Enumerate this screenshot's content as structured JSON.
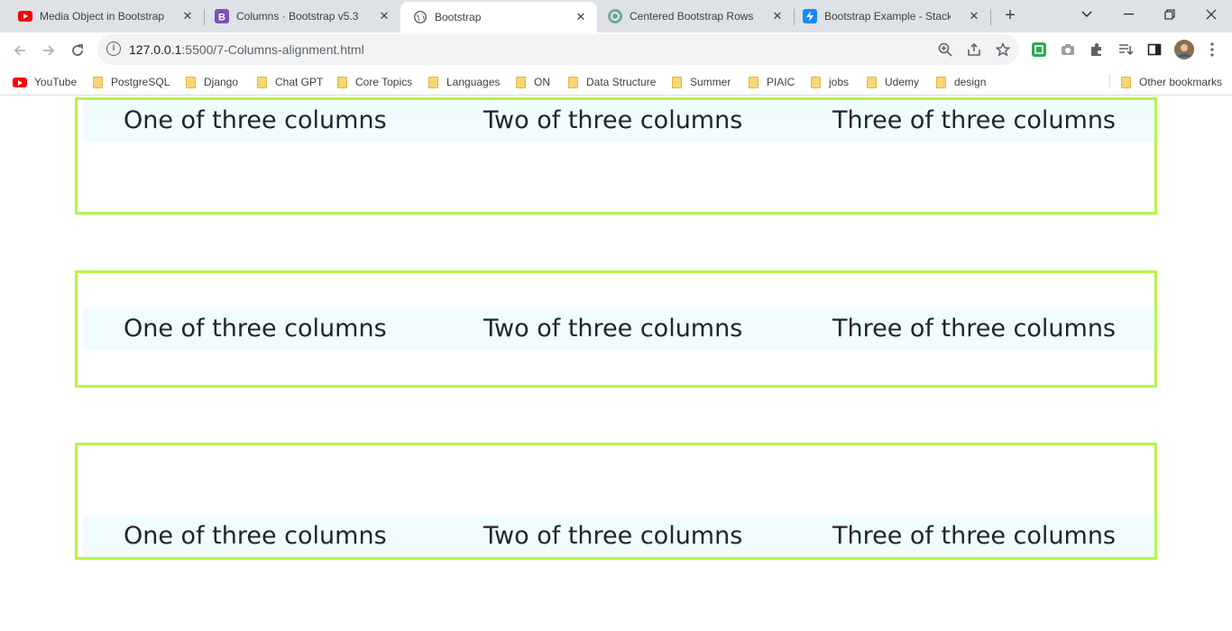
{
  "browser": {
    "tabs": [
      {
        "title": "Media Object in Bootstrap (H",
        "favicon": "youtube-icon"
      },
      {
        "title": "Columns · Bootstrap v5.3",
        "favicon": "bootstrap-icon"
      },
      {
        "title": "Bootstrap",
        "favicon": "globe-icon"
      },
      {
        "title": "Centered Bootstrap Rows",
        "favicon": "chatgpt-icon"
      },
      {
        "title": "Bootstrap Example - StackBlit",
        "favicon": "stackblitz-icon"
      }
    ],
    "active_tab_index": 2,
    "url_host": "127.0.0.1",
    "url_rest": ":5500/7-Columns-alignment.html",
    "bookmarks": [
      "YouTube",
      "PostgreSQL",
      "Django",
      "Chat GPT",
      "Core Topics",
      "Languages",
      "ON",
      "Data Structure",
      "Summer",
      "PIAIC",
      "jobs",
      "Udemy",
      "design"
    ],
    "other_bookmarks": "Other bookmarks"
  },
  "page": {
    "sections": [
      {
        "alignment": "start",
        "columns": [
          "One of three columns",
          "Two of three columns",
          "Three of three columns"
        ]
      },
      {
        "alignment": "center",
        "columns": [
          "One of three columns",
          "Two of three columns",
          "Three of three columns"
        ]
      },
      {
        "alignment": "end",
        "columns": [
          "One of three columns",
          "Two of three columns",
          "Three of three columns"
        ]
      }
    ]
  },
  "colors": {
    "container_border": "#b5f54a",
    "row_background": "#f0fcfd",
    "text": "#212529"
  }
}
